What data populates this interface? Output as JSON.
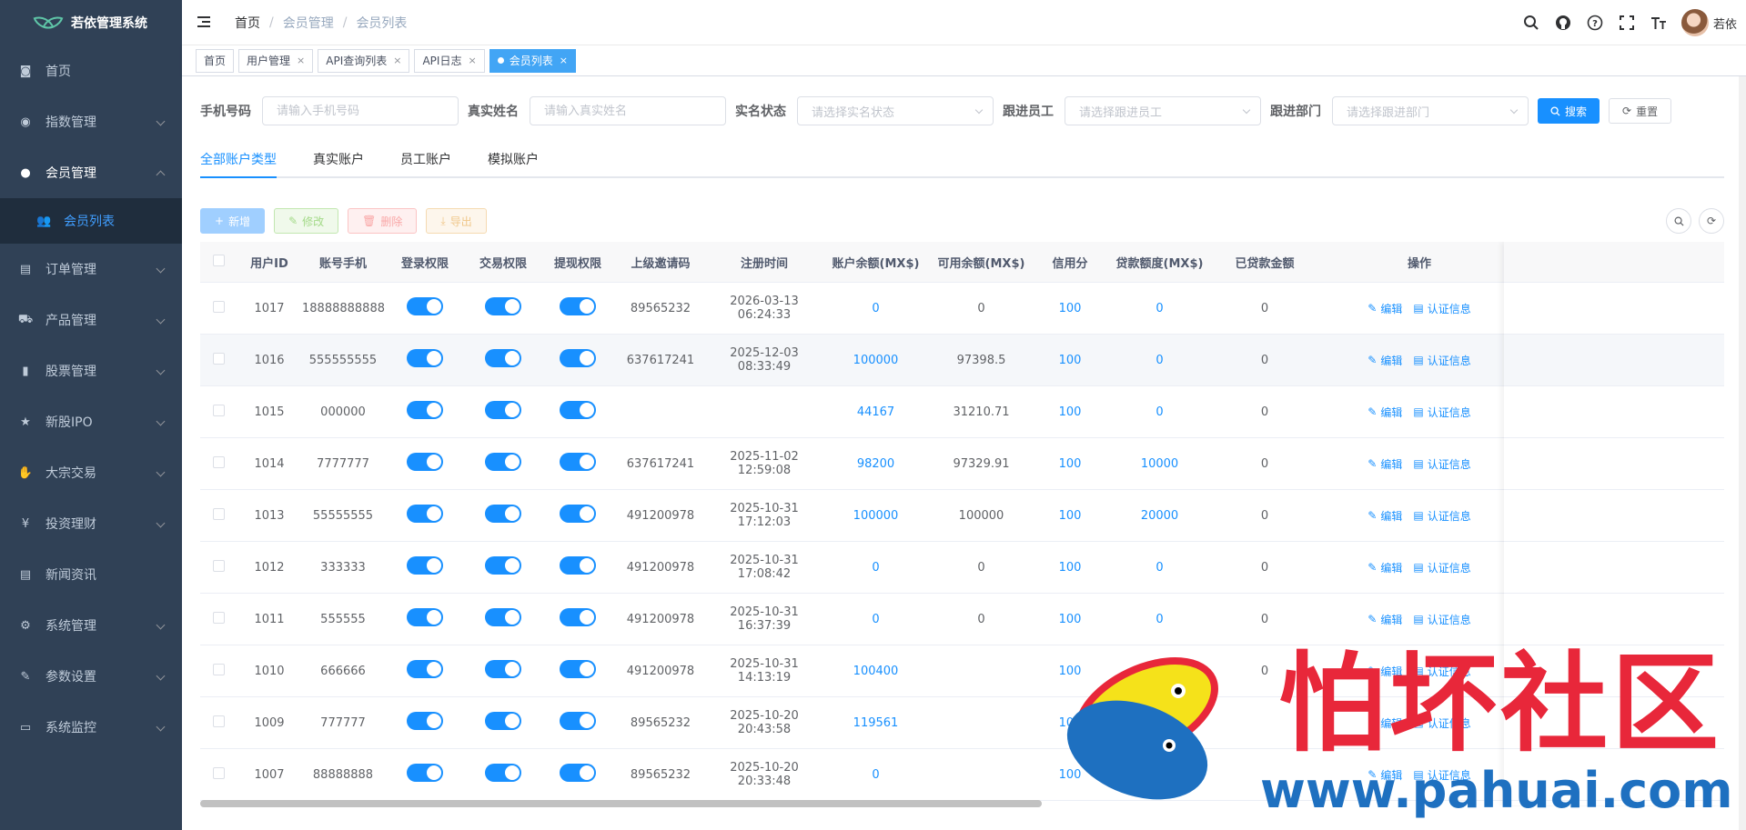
{
  "app": {
    "title": "若依管理系统"
  },
  "sidebar": {
    "items": [
      {
        "label": "首页",
        "icon": "dashboard-icon",
        "glyph": "◙",
        "has_children": false
      },
      {
        "label": "指数管理",
        "icon": "gauge-icon",
        "glyph": "◉",
        "has_children": true
      },
      {
        "label": "会员管理",
        "icon": "user-icon",
        "glyph": "●",
        "has_children": true,
        "open": true
      },
      {
        "label": "订单管理",
        "icon": "document-icon",
        "glyph": "▤",
        "has_children": true
      },
      {
        "label": "产品管理",
        "icon": "cart-icon",
        "glyph": "⛟",
        "has_children": true
      },
      {
        "label": "股票管理",
        "icon": "bar-chart-icon",
        "glyph": "▮",
        "has_children": true
      },
      {
        "label": "新股IPO",
        "icon": "star-icon",
        "glyph": "★",
        "has_children": true
      },
      {
        "label": "大宗交易",
        "icon": "hand-icon",
        "glyph": "✋",
        "has_children": true
      },
      {
        "label": "投资理财",
        "icon": "yen-icon",
        "glyph": "¥",
        "has_children": true
      },
      {
        "label": "新闻资讯",
        "icon": "news-icon",
        "glyph": "▤",
        "has_children": false
      },
      {
        "label": "系统管理",
        "icon": "gear-icon",
        "glyph": "⚙",
        "has_children": true
      },
      {
        "label": "参数设置",
        "icon": "edit-icon",
        "glyph": "✎",
        "has_children": true
      },
      {
        "label": "系统监控",
        "icon": "monitor-icon",
        "glyph": "▭",
        "has_children": true
      }
    ],
    "sub_item": {
      "label": "会员列表",
      "icon": "users-icon",
      "glyph": "👥"
    }
  },
  "breadcrumb": [
    "首页",
    "会员管理",
    "会员列表"
  ],
  "header": {
    "user_name": "若依",
    "icons": [
      "search-icon",
      "github-icon",
      "help-icon",
      "fullscreen-icon",
      "font-size-icon"
    ]
  },
  "tags": [
    {
      "label": "首页",
      "closable": false,
      "active": false
    },
    {
      "label": "用户管理",
      "closable": true,
      "active": false
    },
    {
      "label": "API查询列表",
      "closable": true,
      "active": false
    },
    {
      "label": "API日志",
      "closable": true,
      "active": false
    },
    {
      "label": "会员列表",
      "closable": true,
      "active": true
    }
  ],
  "search": {
    "phone_label": "手机号码",
    "phone_placeholder": "请输入手机号码",
    "name_label": "真实姓名",
    "name_placeholder": "请输入真实姓名",
    "status_label": "实名状态",
    "status_placeholder": "请选择实名状态",
    "staff_label": "跟进员工",
    "staff_placeholder": "请选择跟进员工",
    "dept_label": "跟进部门",
    "dept_placeholder": "请选择跟进部门",
    "search_btn": "搜索",
    "reset_btn": "重置"
  },
  "account_tabs": [
    "全部账户类型",
    "真实账户",
    "员工账户",
    "模拟账户"
  ],
  "toolbar": {
    "add": "新增",
    "edit": "修改",
    "delete": "删除",
    "export": "导出"
  },
  "table": {
    "columns": [
      "用户ID",
      "账号手机",
      "登录权限",
      "交易权限",
      "提现权限",
      "上级邀请码",
      "注册时间",
      "账户余额(MX$)",
      "可用余额(MX$)",
      "信用分",
      "贷款额度(MX$)",
      "已贷款金额",
      "操作"
    ],
    "ops": {
      "edit": "编辑",
      "verify": "认证信息"
    },
    "rows": [
      {
        "id": "1017",
        "phone": "18888888888",
        "code": "89565232",
        "time": "2026-03-13 06:24:33",
        "balance": "0",
        "available": "0",
        "credit": "100",
        "loan_limit": "0",
        "loaned": "0"
      },
      {
        "id": "1016",
        "phone": "555555555",
        "code": "637617241",
        "time": "2025-12-03 08:33:49",
        "balance": "100000",
        "available": "97398.5",
        "credit": "100",
        "loan_limit": "0",
        "loaned": "0"
      },
      {
        "id": "1015",
        "phone": "000000",
        "code": "",
        "time": "",
        "balance": "44167",
        "available": "31210.71",
        "credit": "100",
        "loan_limit": "0",
        "loaned": "0"
      },
      {
        "id": "1014",
        "phone": "7777777",
        "code": "637617241",
        "time": "2025-11-02 12:59:08",
        "balance": "98200",
        "available": "97329.91",
        "credit": "100",
        "loan_limit": "10000",
        "loaned": "0"
      },
      {
        "id": "1013",
        "phone": "55555555",
        "code": "491200978",
        "time": "2025-10-31 17:12:03",
        "balance": "100000",
        "available": "100000",
        "credit": "100",
        "loan_limit": "20000",
        "loaned": "0"
      },
      {
        "id": "1012",
        "phone": "333333",
        "code": "491200978",
        "time": "2025-10-31 17:08:42",
        "balance": "0",
        "available": "0",
        "credit": "100",
        "loan_limit": "0",
        "loaned": "0"
      },
      {
        "id": "1011",
        "phone": "555555",
        "code": "491200978",
        "time": "2025-10-31 16:37:39",
        "balance": "0",
        "available": "0",
        "credit": "100",
        "loan_limit": "0",
        "loaned": "0"
      },
      {
        "id": "1010",
        "phone": "666666",
        "code": "491200978",
        "time": "2025-10-31 14:13:19",
        "balance": "100400",
        "available": "",
        "credit": "100",
        "loan_limit": "",
        "loaned": "0"
      },
      {
        "id": "1009",
        "phone": "777777",
        "code": "89565232",
        "time": "2025-10-20 20:43:58",
        "balance": "119561",
        "available": "",
        "credit": "100",
        "loan_limit": "",
        "loaned": ""
      },
      {
        "id": "1007",
        "phone": "88888888",
        "code": "89565232",
        "time": "2025-10-20 20:33:48",
        "balance": "0",
        "available": "",
        "credit": "100",
        "loan_limit": "",
        "loaned": ""
      }
    ]
  },
  "watermark": {
    "cn": "怕坏社区",
    "url": "www.pahuai.com"
  },
  "colors": {
    "sidebar_bg": "#304156",
    "primary": "#1890ff",
    "watermark_red": "#e8273a",
    "watermark_blue": "#1e70c0"
  }
}
